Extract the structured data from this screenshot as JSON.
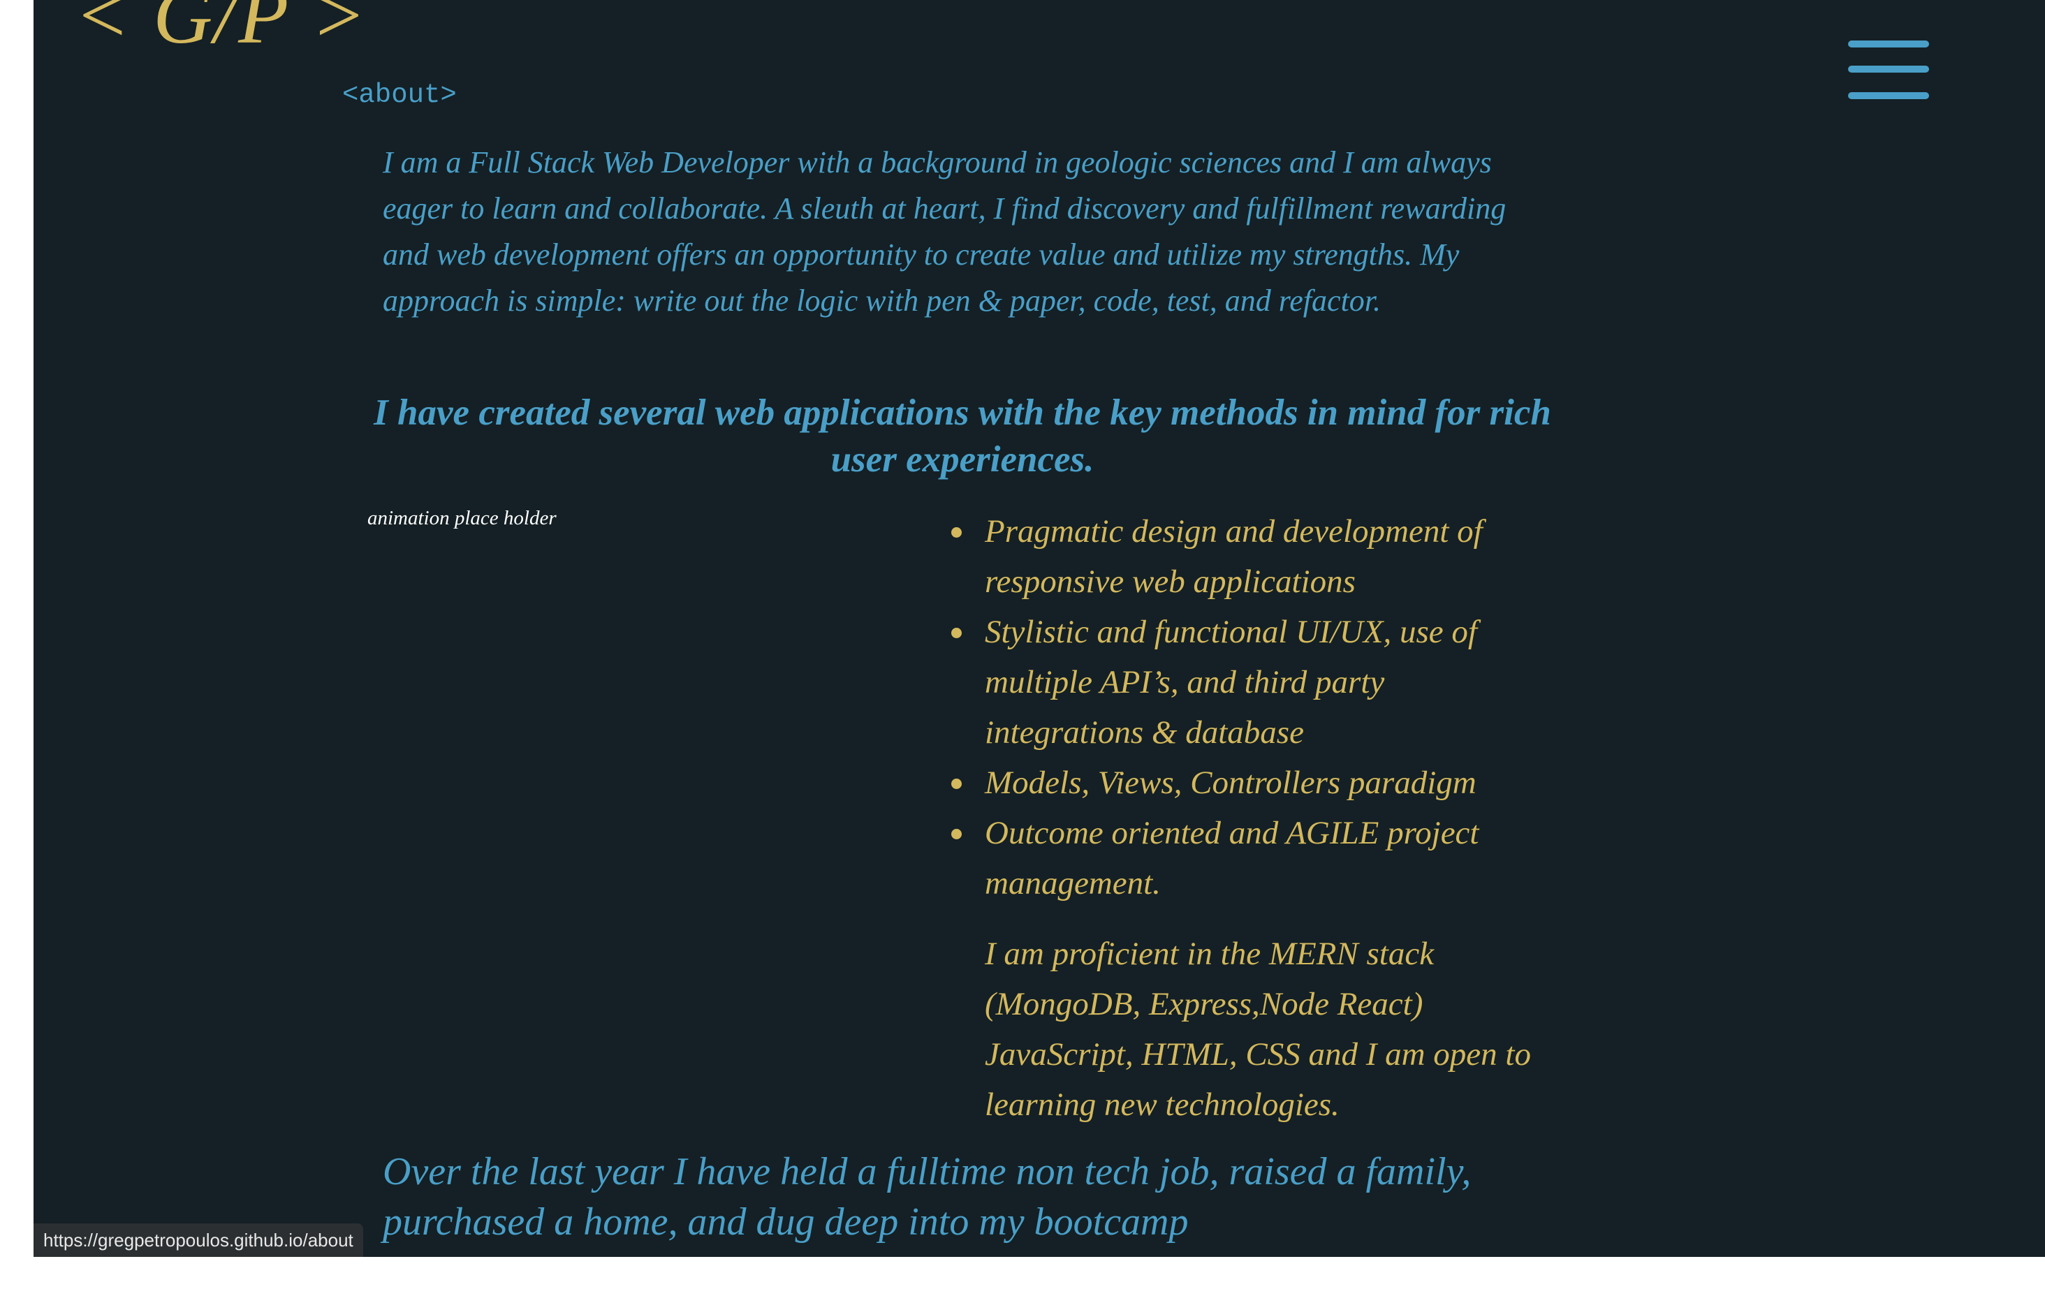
{
  "header": {
    "logo_text": "< G/P >",
    "menu_icon": "hamburger-menu-icon"
  },
  "about": {
    "tag": "<about>",
    "intro": "I am a Full Stack Web Developer with a background in geologic sciences and I am always eager to learn and collaborate. A sleuth at heart, I find discovery and fulfillment rewarding and web development offers an opportunity to create value and utilize my strengths. My approach is simple: write out the logic with pen & paper, code, test, and refactor.",
    "key_heading": "I have created several web applications with the key methods in mind for rich user experiences.",
    "animation_placeholder": "animation place holder",
    "methods": [
      "Pragmatic design and development of responsive web applications",
      "Stylistic and functional UI/UX, use of multiple API’s, and third party integrations & database",
      "Models, Views, Controllers paradigm",
      "Outcome oriented and AGILE project management."
    ],
    "stack_text": "I am proficient in the MERN stack (MongoDB, Express,Node React) JavaScript, HTML, CSS and I am open to learning new technologies.",
    "year_text": "Over the last year I have held a fulltime non tech job, raised a family, purchased a home, and dug deep into my bootcamp"
  },
  "status_bar": {
    "url": "https://gregpetropoulos.github.io/about"
  },
  "colors": {
    "background": "#142025",
    "accent_blue": "#4a9fc8",
    "accent_gold": "#d4b85d"
  }
}
